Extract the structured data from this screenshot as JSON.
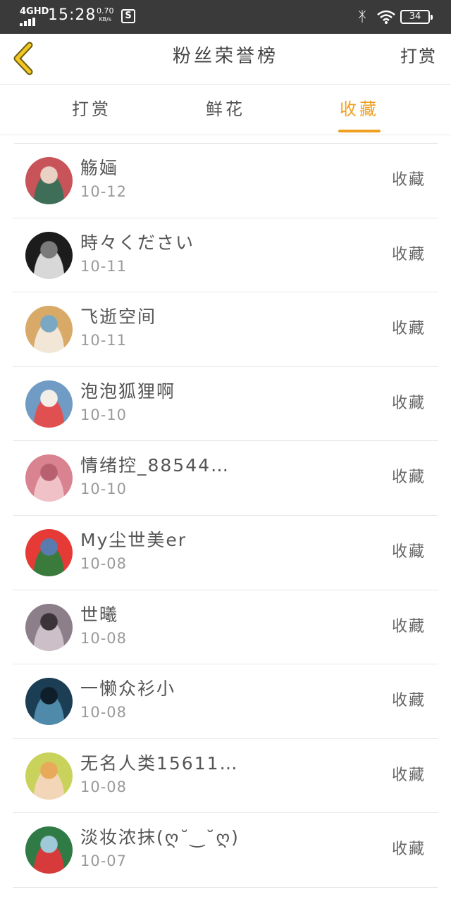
{
  "status_bar": {
    "network": "4GHD",
    "time": "15:28",
    "speed_value": "0.70",
    "speed_unit": "KB/s",
    "app_icon": "S",
    "battery": "34"
  },
  "header": {
    "back_icon": "chevron-left-icon",
    "title": "粉丝荣誉榜",
    "action_label": "打赏"
  },
  "tabs": [
    {
      "label": "打赏",
      "active": false
    },
    {
      "label": "鲜花",
      "active": false
    },
    {
      "label": "收藏",
      "active": true
    }
  ],
  "colors": {
    "accent": "#f0a020",
    "status_bar": "#3a3a3a"
  },
  "fans": [
    {
      "name": "觞婳",
      "date": "10-12",
      "type": "收藏",
      "avatar_colors": [
        "#c8545a",
        "#3f6e58",
        "#e9d2c4"
      ]
    },
    {
      "name": "時々ください",
      "date": "10-11",
      "type": "收藏",
      "avatar_colors": [
        "#1c1c1c",
        "#d8d8d8",
        "#7a7a7a"
      ]
    },
    {
      "name": "飞逝空间",
      "date": "10-11",
      "type": "收藏",
      "avatar_colors": [
        "#d9a968",
        "#f2e6d6",
        "#7aa8c2"
      ]
    },
    {
      "name": "泡泡狐狸啊",
      "date": "10-10",
      "type": "收藏",
      "avatar_colors": [
        "#6f9bc4",
        "#e05050",
        "#f3efe8"
      ]
    },
    {
      "name": "情绪控_88544…",
      "date": "10-10",
      "type": "收藏",
      "avatar_colors": [
        "#d98390",
        "#f0c2c8",
        "#b86070"
      ]
    },
    {
      "name": "My尘世美er",
      "date": "10-08",
      "type": "收藏",
      "avatar_colors": [
        "#e53a36",
        "#3a7a3a",
        "#5a7bb0"
      ]
    },
    {
      "name": "世曦",
      "date": "10-08",
      "type": "收藏",
      "avatar_colors": [
        "#8c7f8a",
        "#cdbfc8",
        "#3c3338"
      ]
    },
    {
      "name": "一懒众衫小",
      "date": "10-08",
      "type": "收藏",
      "avatar_colors": [
        "#1b3e55",
        "#4f8aaa",
        "#0e1e2a"
      ]
    },
    {
      "name": "无名人类15611…",
      "date": "10-08",
      "type": "收藏",
      "avatar_colors": [
        "#c9d25a",
        "#f3d6b8",
        "#e8aa5a"
      ]
    },
    {
      "name": "淡妆浓抹(ღ˘‿˘ღ)",
      "date": "10-07",
      "type": "收藏",
      "avatar_colors": [
        "#2f7a45",
        "#d63a3a",
        "#9fc8d8"
      ]
    }
  ]
}
